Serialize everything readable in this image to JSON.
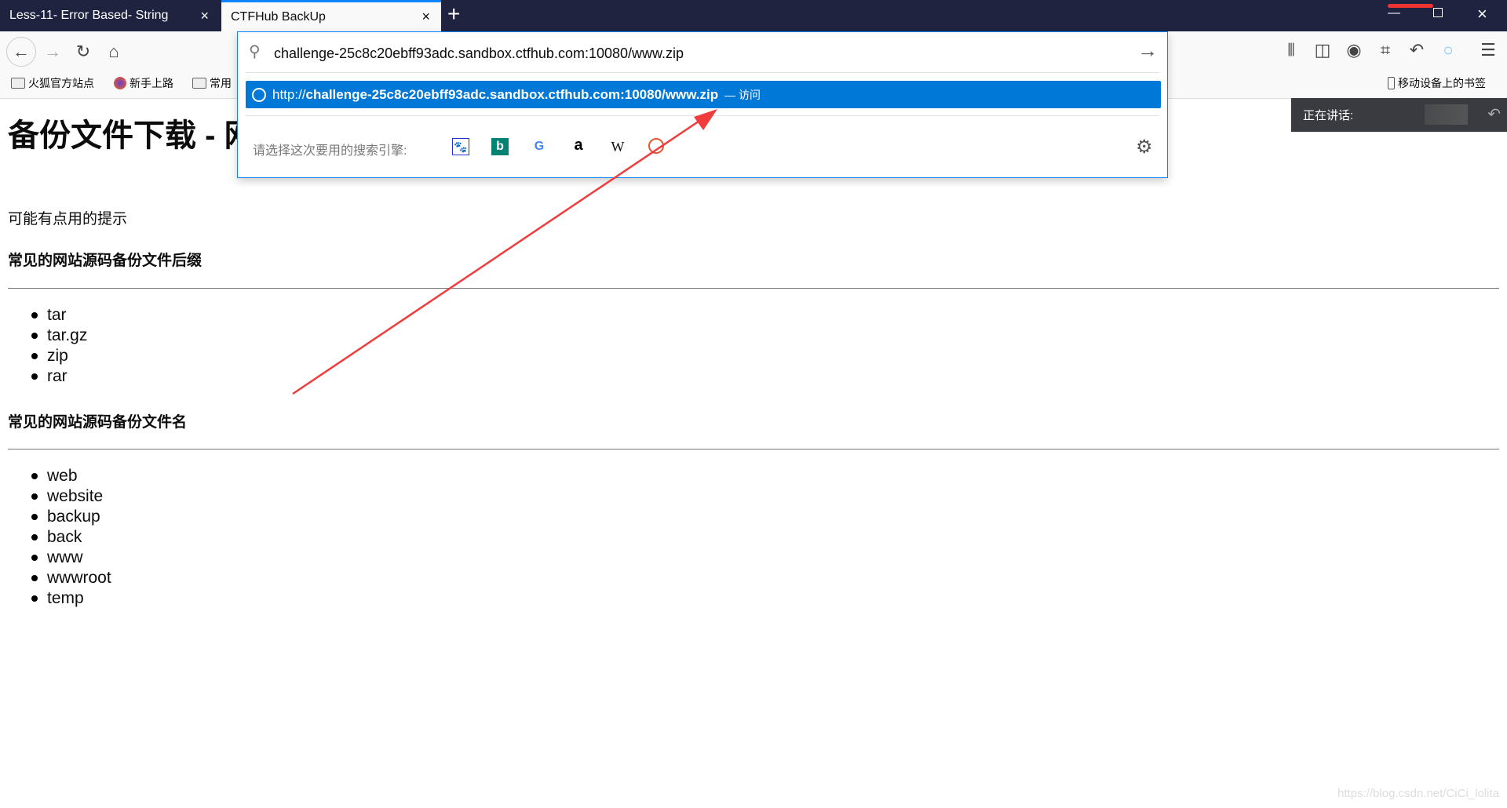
{
  "tabs": [
    {
      "title": "Less-11- Error Based- String",
      "active": false
    },
    {
      "title": "CTFHub BackUp",
      "active": true
    }
  ],
  "icons": {
    "close": "×",
    "new_tab": "+",
    "back": "←",
    "forward": "→",
    "reload": "↻",
    "home": "⌂",
    "go": "→",
    "settings": "⚙",
    "menu": "☰"
  },
  "bookmarks": [
    "火狐官方站点",
    "新手上路",
    "常用"
  ],
  "mobile_bookmarks": "移动设备上的书签",
  "urlbar": {
    "value": "challenge-25c8c20ebff93adc.sandbox.ctfhub.com:10080/www.zip",
    "suggestion_prefix": "http://",
    "suggestion_url": "challenge-25c8c20ebff93adc.sandbox.ctfhub.com:10080/www.zip",
    "suggestion_action": "— 访问",
    "search_prompt": "请选择这次要用的搜索引擎:",
    "engines": [
      "baidu",
      "bing",
      "google",
      "amazon",
      "wikipedia",
      "duckduckgo"
    ]
  },
  "speaking": "正在讲话:",
  "page": {
    "title": "备份文件下载 - 网",
    "hint": "可能有点用的提示",
    "h_suffix": "常见的网站源码备份文件后缀",
    "suffixes": [
      "tar",
      "tar.gz",
      "zip",
      "rar"
    ],
    "h_names": "常见的网站源码备份文件名",
    "names": [
      "web",
      "website",
      "backup",
      "back",
      "www",
      "wwwroot",
      "temp"
    ]
  },
  "watermark": "https://blog.csdn.net/CiCi_lolita",
  "colors": {
    "accent": "#0078d7",
    "tabbar": "#202340",
    "arrow": "#f03c3c"
  }
}
